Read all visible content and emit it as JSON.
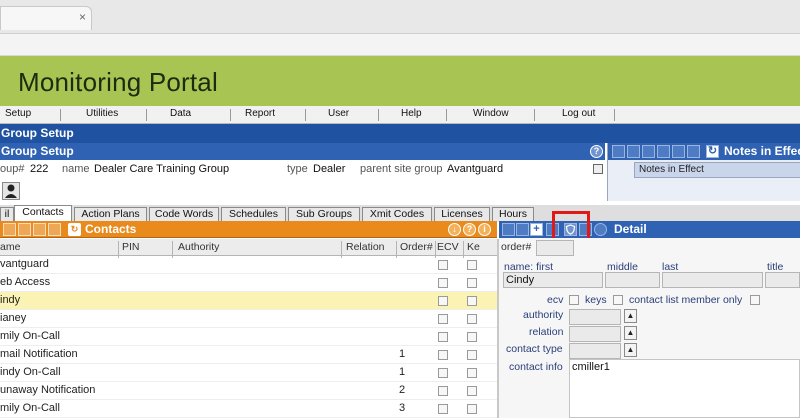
{
  "browser": {
    "tab_close": "×"
  },
  "app": {
    "title": "Monitoring Portal"
  },
  "menu": [
    "Setup",
    "Utilities",
    "Data",
    "Report",
    "User",
    "Help",
    "Window",
    "Log out"
  ],
  "group_setup": {
    "outer_title": "Group Setup",
    "inner_title": "Group Setup",
    "help": "?",
    "group_label": "oup#",
    "group_value": "222",
    "name_label": "name",
    "name_value": "Dealer Care Training Group",
    "type_label": "type",
    "type_value": "Dealer",
    "parent_label": "parent site group",
    "parent_value": "Avantguard"
  },
  "notes": {
    "title": "Notes in Effec",
    "column": "Notes in Effect"
  },
  "tabs": [
    "il",
    "Contacts",
    "Action Plans",
    "Code Words",
    "Schedules",
    "Sub Groups",
    "Xmit Codes",
    "Licenses",
    "Hours"
  ],
  "active_tab": "Contacts",
  "contacts": {
    "title": "Contacts",
    "columns": {
      "name": "ame",
      "pin": "PIN",
      "authority": "Authority",
      "relation": "Relation",
      "order": "Order#",
      "ecv": "ECV",
      "keys": "Ke"
    },
    "rows": [
      {
        "name": "vantguard",
        "order": ""
      },
      {
        "name": "eb Access",
        "order": ""
      },
      {
        "name": "indy",
        "order": ""
      },
      {
        "name": "ianey",
        "order": ""
      },
      {
        "name": "mily On-Call",
        "order": ""
      },
      {
        "name": "mail Notification",
        "order": "1"
      },
      {
        "name": "indy On-Call",
        "order": "1"
      },
      {
        "name": "unaway Notification",
        "order": "2"
      },
      {
        "name": "mily On-Call",
        "order": "3"
      }
    ]
  },
  "detail": {
    "title": "Detail",
    "order_label": "order#",
    "name_first_label": "name: first",
    "middle_label": "middle",
    "last_label": "last",
    "title_label": "title",
    "first_value": "Cindy",
    "ecv_label": "ecv",
    "keys_label": "keys",
    "contact_list_label": "contact list member only",
    "authority_label": "authority",
    "relation_label": "relation",
    "contact_type_label": "contact type",
    "contact_info_label": "contact info",
    "contact_info_value": "cmiller1"
  },
  "colors": {
    "banner": "#a8c452",
    "blue_bar": "#1f52a0",
    "contacts_orange": "#e98a1c",
    "highlight": "#e01818",
    "selected_row": "#fbf3b4"
  }
}
